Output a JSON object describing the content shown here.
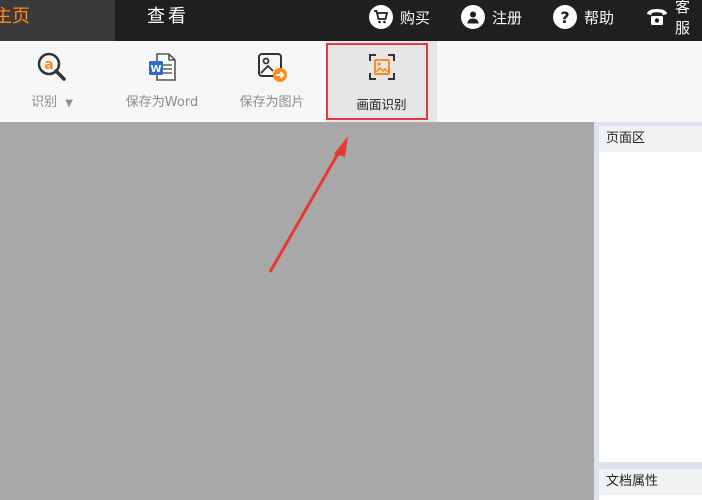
{
  "menu": {
    "home_tab": "主页",
    "view_tab": "查看",
    "buy": "购买",
    "register": "注册",
    "help": "帮助",
    "service": "客服"
  },
  "toolbar": {
    "recognize": "识别",
    "dropdown_arrow": "▼",
    "save_word": "保存为Word",
    "save_image": "保存为图片",
    "screen_ocr": "画面识别"
  },
  "sidepanel": {
    "page_area": "页面区",
    "doc_props": "文档属性"
  },
  "colors": {
    "accent": "#ff8a1c",
    "highlight": "#e53935",
    "topbar": "#1f1f1f",
    "canvas": "#a8a8a8"
  }
}
